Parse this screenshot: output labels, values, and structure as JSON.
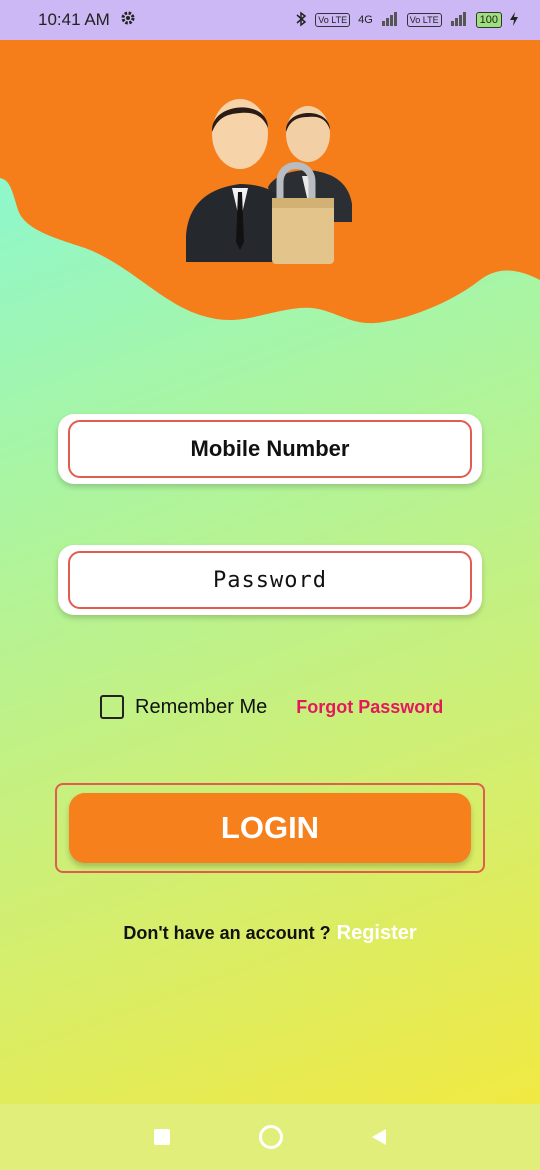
{
  "status_bar": {
    "time": "10:41 AM",
    "volte1": "Vo LTE",
    "network": "4G",
    "volte2": "Vo LTE",
    "battery": "100"
  },
  "form": {
    "mobile_label": "Mobile Number",
    "password_label": "Password",
    "remember_label": "Remember Me",
    "remember_checked": false,
    "forgot_label": "Forgot Password",
    "login_label": "LOGIN",
    "no_account_text": "Don't have an account ?",
    "register_label": "Register"
  },
  "colors": {
    "header_orange": "#f67e1a",
    "login_button": "#f5801c",
    "forgot_link": "#e4185c",
    "field_border": "#e25b4f",
    "status_bar": "#cbb8f4",
    "nav_bar": "#e1ef7a"
  },
  "icons": {
    "settings": "gear-icon",
    "bluetooth": "bluetooth-icon",
    "signal": "signal-icon",
    "battery": "battery-icon",
    "charging": "charging-icon",
    "avatar": "users-lock-icon",
    "nav_recents": "square-icon",
    "nav_home": "circle-icon",
    "nav_back": "triangle-back-icon"
  }
}
